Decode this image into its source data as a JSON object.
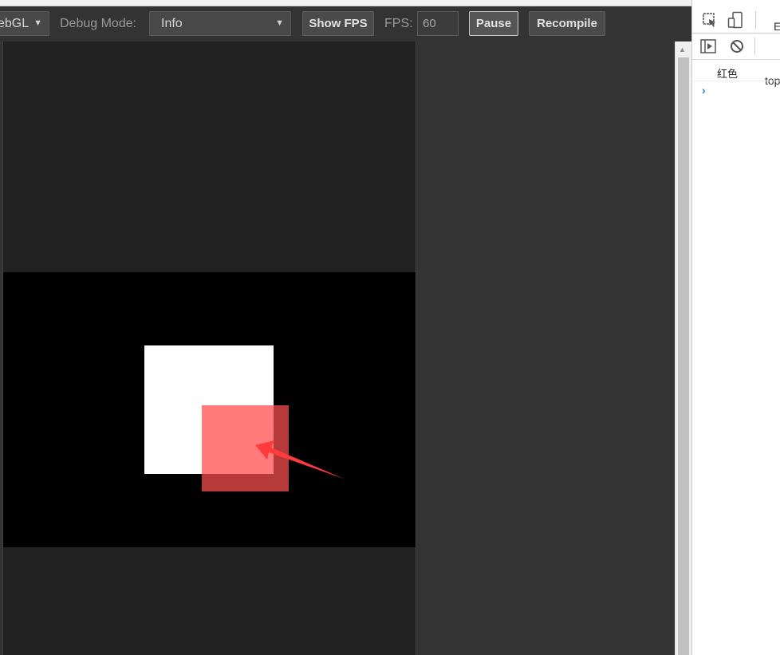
{
  "toolbar": {
    "renderer_select": "ebGL",
    "debug_mode_label": "Debug Mode:",
    "debug_mode_value": "Info",
    "show_fps_label": "Show FPS",
    "fps_label": "FPS:",
    "fps_value": "60",
    "pause_label": "Pause",
    "recompile_label": "Recompile"
  },
  "canvas": {
    "colors": {
      "background": "#222222",
      "scene": "#000000",
      "white_square": "#ffffff",
      "red_overlap": "#ff7b7b",
      "red_square": "#b63a3a",
      "annotation_arrow": "#ff3b3b"
    }
  },
  "devtools": {
    "first_tab": "E",
    "context": "top",
    "console_output": "红色",
    "prompt_symbol": "›",
    "icons": [
      "inspect-element-icon",
      "device-toolbar-icon",
      "show-sidebar-icon",
      "clear-console-icon"
    ]
  }
}
